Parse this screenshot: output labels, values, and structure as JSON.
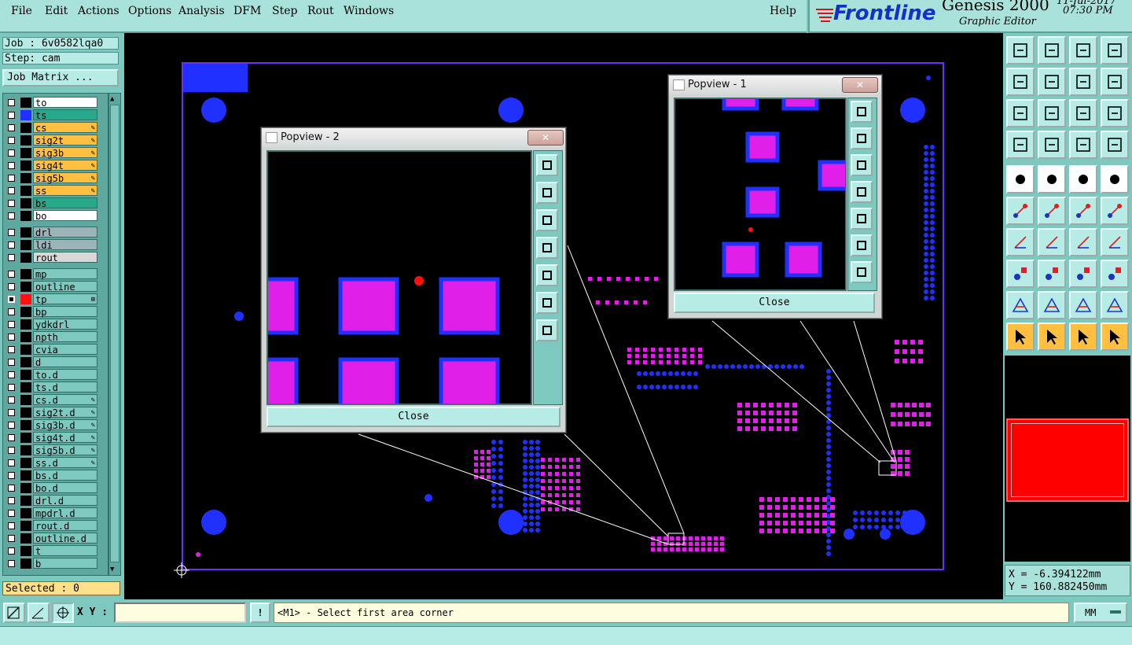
{
  "menu": {
    "items": [
      "File",
      "Edit",
      "Actions",
      "Options",
      "Analysis",
      "DFM",
      "Step",
      "Rout",
      "Windows"
    ],
    "help": "Help"
  },
  "brand": {
    "logo_text": "Frontline",
    "product": "Genesis 2000",
    "subtitle": "Graphic Editor",
    "date": "11-Jul-2017",
    "time": "07:30 PM"
  },
  "job": {
    "job_label": "Job : 6v0582lqa0",
    "step_label": "Step: cam",
    "matrix_button": "Job Matrix ...",
    "selected": "Selected : 0"
  },
  "layers": [
    {
      "name": "to",
      "bg": "#ffffff",
      "sw": "#000000",
      "edit": false
    },
    {
      "name": "ts",
      "bg": "#2aa98a",
      "sw": "#2030ff",
      "edit": false
    },
    {
      "name": "cs",
      "bg": "#ffc040",
      "sw": "#000000",
      "edit": true
    },
    {
      "name": "sig2t",
      "bg": "#ffc040",
      "sw": "#000000",
      "edit": true
    },
    {
      "name": "sig3b",
      "bg": "#ffc040",
      "sw": "#000000",
      "edit": true
    },
    {
      "name": "sig4t",
      "bg": "#ffc040",
      "sw": "#000000",
      "edit": true
    },
    {
      "name": "sig5b",
      "bg": "#ffc040",
      "sw": "#000000",
      "edit": true
    },
    {
      "name": "ss",
      "bg": "#ffc040",
      "sw": "#000000",
      "edit": true
    },
    {
      "name": "bs",
      "bg": "#2aa98a",
      "sw": "#000000",
      "edit": false
    },
    {
      "name": "bo",
      "bg": "#ffffff",
      "sw": "#000000",
      "edit": false
    },
    {
      "name": "drl",
      "bg": "#9cb4b8",
      "sw": "#000000",
      "edit": false,
      "gap": true
    },
    {
      "name": "ldi",
      "bg": "#9cb4b8",
      "sw": "#000000",
      "edit": false
    },
    {
      "name": "rout",
      "bg": "#d8d8d8",
      "sw": "#000000",
      "edit": false
    },
    {
      "name": "mp",
      "bg": "#7ec9bf",
      "sw": "#000000",
      "edit": false,
      "gap": true
    },
    {
      "name": "outline",
      "bg": "#7ec9bf",
      "sw": "#000000",
      "edit": false
    },
    {
      "name": "tp",
      "bg": "#7ec9bf",
      "sw": "#ff1010",
      "edit": false,
      "active": true
    },
    {
      "name": "bp",
      "bg": "#7ec9bf",
      "sw": "#000000",
      "edit": false
    },
    {
      "name": "ydkdrl",
      "bg": "#7ec9bf",
      "sw": "#000000",
      "edit": false
    },
    {
      "name": "npth",
      "bg": "#7ec9bf",
      "sw": "#000000",
      "edit": false
    },
    {
      "name": "cvia",
      "bg": "#7ec9bf",
      "sw": "#000000",
      "edit": false
    },
    {
      "name": "d",
      "bg": "#7ec9bf",
      "sw": "#000000",
      "edit": false
    },
    {
      "name": "to.d",
      "bg": "#7ec9bf",
      "sw": "#000000",
      "edit": false
    },
    {
      "name": "ts.d",
      "bg": "#7ec9bf",
      "sw": "#000000",
      "edit": false
    },
    {
      "name": "cs.d",
      "bg": "#7ec9bf",
      "sw": "#000000",
      "edit": true
    },
    {
      "name": "sig2t.d",
      "bg": "#7ec9bf",
      "sw": "#000000",
      "edit": true
    },
    {
      "name": "sig3b.d",
      "bg": "#7ec9bf",
      "sw": "#000000",
      "edit": true
    },
    {
      "name": "sig4t.d",
      "bg": "#7ec9bf",
      "sw": "#000000",
      "edit": true
    },
    {
      "name": "sig5b.d",
      "bg": "#7ec9bf",
      "sw": "#000000",
      "edit": true
    },
    {
      "name": "ss.d",
      "bg": "#7ec9bf",
      "sw": "#000000",
      "edit": true
    },
    {
      "name": "bs.d",
      "bg": "#7ec9bf",
      "sw": "#000000",
      "edit": false
    },
    {
      "name": "bo.d",
      "bg": "#7ec9bf",
      "sw": "#000000",
      "edit": false
    },
    {
      "name": "drl.d",
      "bg": "#7ec9bf",
      "sw": "#000000",
      "edit": false
    },
    {
      "name": "mpdrl.d",
      "bg": "#7ec9bf",
      "sw": "#000000",
      "edit": false
    },
    {
      "name": "rout.d",
      "bg": "#7ec9bf",
      "sw": "#000000",
      "edit": false
    },
    {
      "name": "outline.d",
      "bg": "#7ec9bf",
      "sw": "#000000",
      "edit": false
    },
    {
      "name": "t",
      "bg": "#7ec9bf",
      "sw": "#000000",
      "edit": false
    },
    {
      "name": "b",
      "bg": "#7ec9bf",
      "sw": "#000000",
      "edit": false
    }
  ],
  "popview1": {
    "title": "Popview - 1",
    "close": "Close"
  },
  "popview2": {
    "title": "Popview - 2",
    "close": "Close"
  },
  "coords": {
    "x": "X = -6.394122mm",
    "y": "Y = 160.882450mm"
  },
  "bottom": {
    "xy_label": "X Y :",
    "xy_value": "",
    "prompt": "<M1> - Select first area corner",
    "units": "MM"
  },
  "colors": {
    "pad": "#e020e8",
    "pad_border": "#2030ff",
    "via": "#2030ff",
    "board_outline": "#6a30ff",
    "mark": "#ff1010"
  }
}
